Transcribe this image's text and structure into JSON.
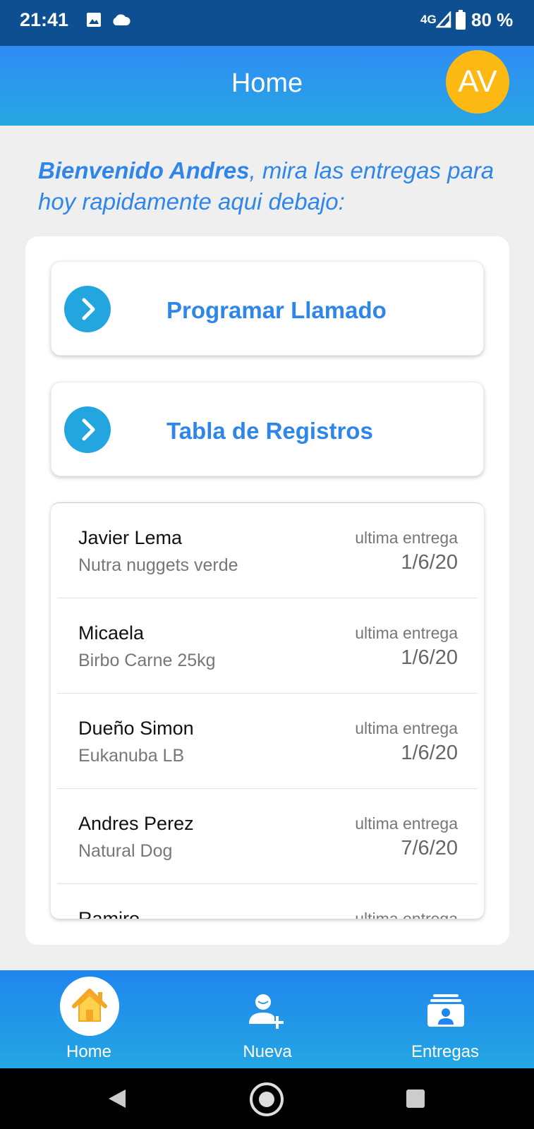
{
  "status_bar": {
    "time": "21:41",
    "network": "4G",
    "battery": "80 %"
  },
  "header": {
    "title": "Home",
    "avatar_initials": "AV"
  },
  "welcome": {
    "name": "Bienvenido Andres",
    "rest": ", mira las entregas para hoy rapidamente aqui debajo:"
  },
  "actions": [
    {
      "label": "Programar Llamado",
      "icon": "chevron-right-icon"
    },
    {
      "label": "Tabla de Registros",
      "icon": "chevron-right-icon"
    }
  ],
  "deliveries": [
    {
      "name": "Javier Lema",
      "product": "Nutra nuggets verde",
      "label": "ultima entrega",
      "date": "1/6/20"
    },
    {
      "name": "Micaela",
      "product": "Birbo Carne 25kg",
      "label": "ultima entrega",
      "date": "1/6/20"
    },
    {
      "name": "Dueño Simon",
      "product": "Eukanuba LB",
      "label": "ultima entrega",
      "date": "1/6/20"
    },
    {
      "name": "Andres Perez",
      "product": "Natural Dog",
      "label": "ultima entrega",
      "date": "7/6/20"
    },
    {
      "name": "Ramiro",
      "product": "",
      "label": "ultima entrega",
      "date": ""
    }
  ],
  "bottom_nav": [
    {
      "label": "Home",
      "icon": "home-icon",
      "active": true
    },
    {
      "label": "Nueva",
      "icon": "add-user-icon",
      "active": false
    },
    {
      "label": "Entregas",
      "icon": "deliveries-icon",
      "active": false
    }
  ],
  "colors": {
    "header": "#2f8cf5",
    "accent": "#2f86ea",
    "avatar": "#fdb913",
    "status_bar": "#0d4f91"
  }
}
